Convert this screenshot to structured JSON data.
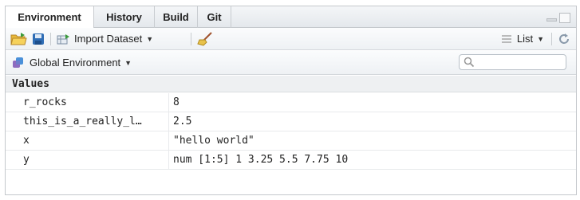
{
  "tabs": [
    {
      "label": "Environment",
      "active": true
    },
    {
      "label": "History"
    },
    {
      "label": "Build"
    },
    {
      "label": "Git"
    }
  ],
  "toolbar": {
    "import_label": "Import Dataset",
    "view_label": "List"
  },
  "env_selector": {
    "label": "Global Environment"
  },
  "search": {
    "placeholder": ""
  },
  "section": {
    "title": "Values"
  },
  "values": [
    {
      "name": "r_rocks",
      "value": "8"
    },
    {
      "name": "this_is_a_really_l…",
      "value": "2.5"
    },
    {
      "name": "x",
      "value": "\"hello world\""
    },
    {
      "name": "y",
      "value": "num [1:5] 1 3.25 5.5 7.75 10"
    }
  ],
  "colors": {
    "accent": "#4a90d9",
    "folder": "#f0c040",
    "disk": "#2f6db5"
  }
}
